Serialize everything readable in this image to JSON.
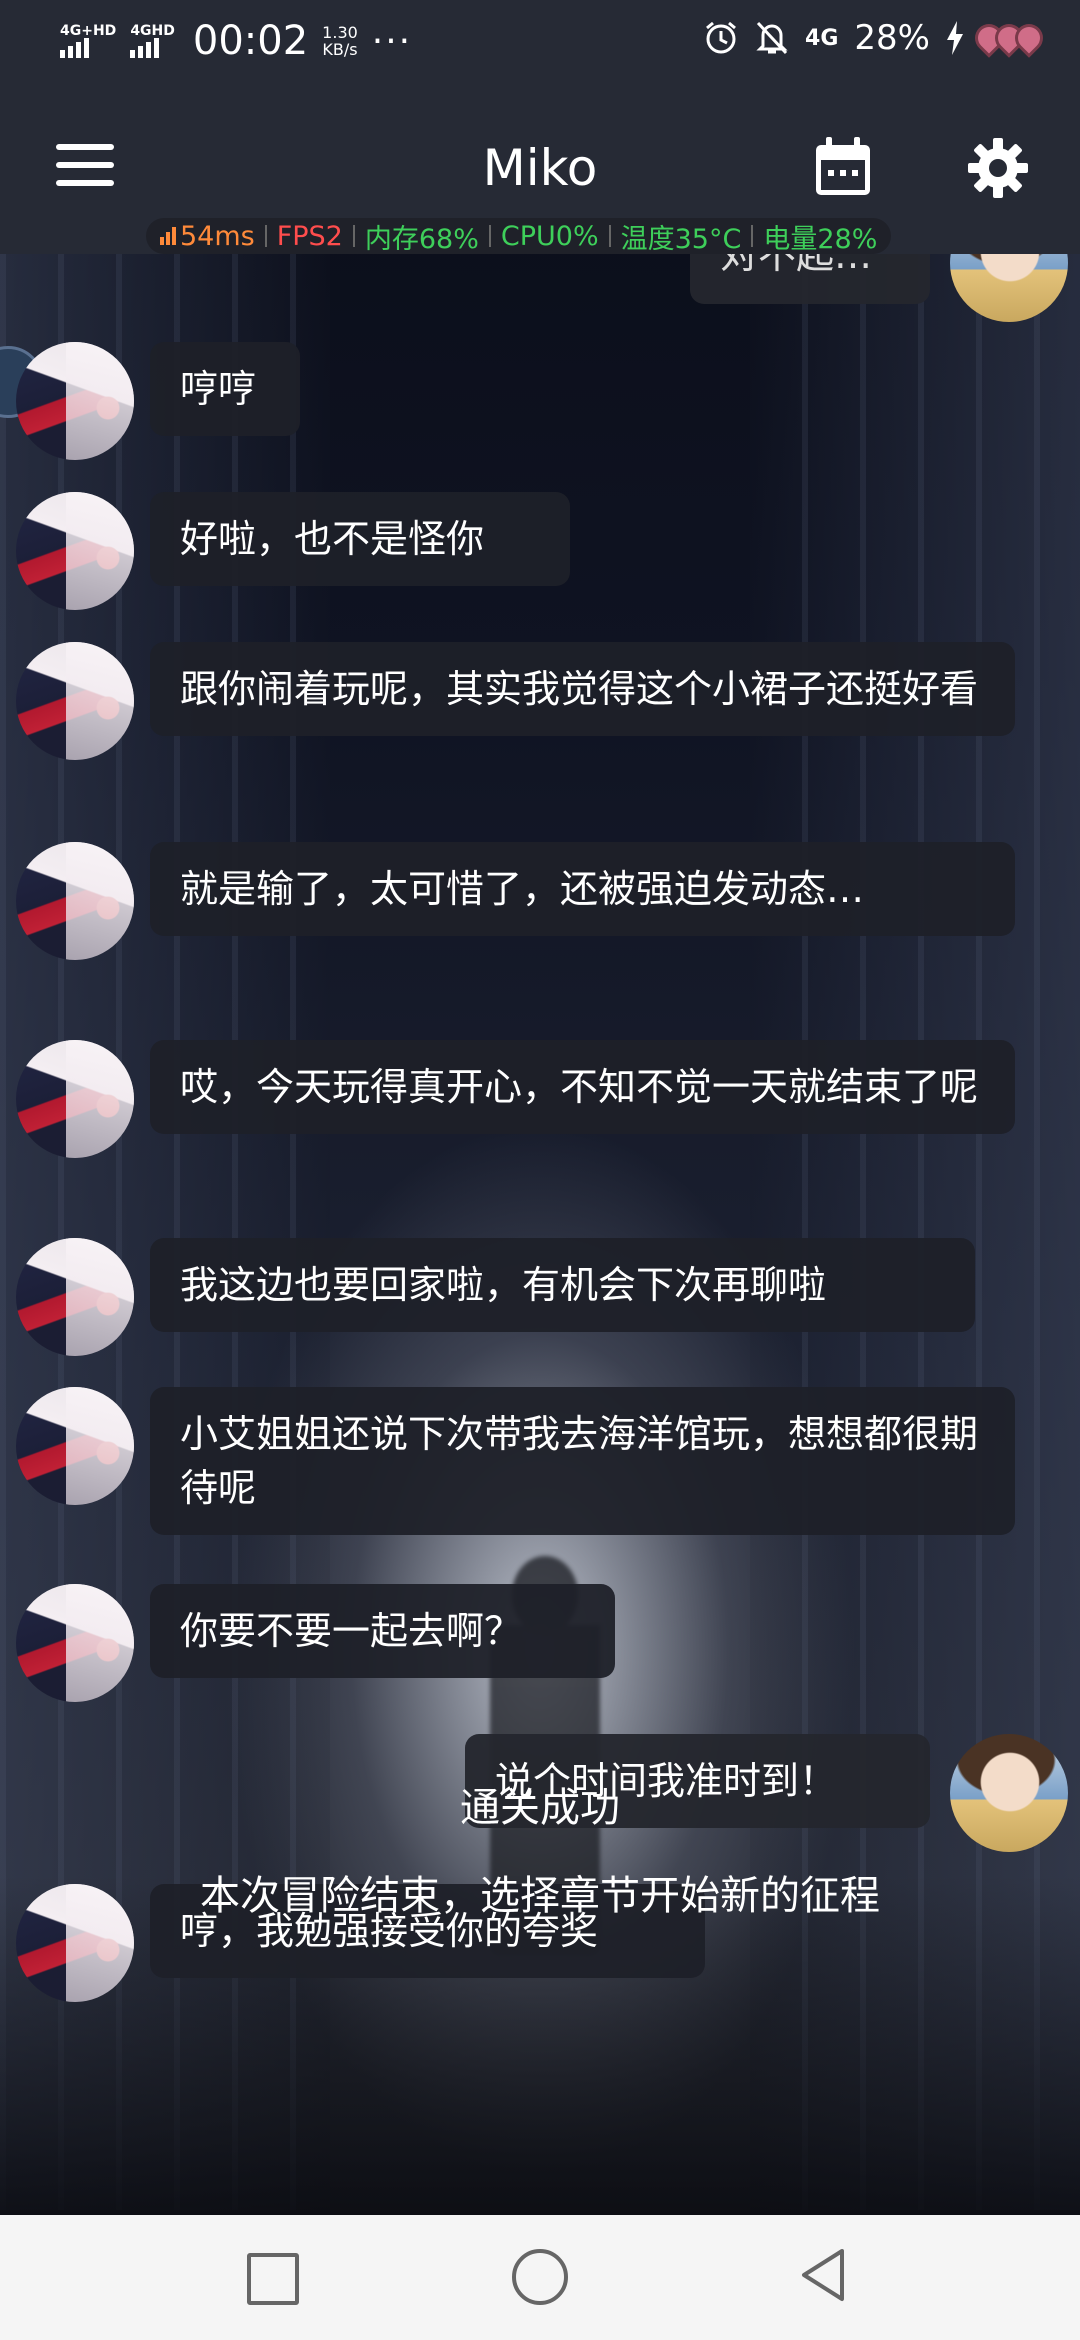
{
  "status_bar": {
    "net1": "4G+HD",
    "net2": "4GHD",
    "time": "00:02",
    "speed_value": "1.30",
    "speed_unit": "KB/s",
    "more": "···",
    "net3": "4G",
    "battery": "28%"
  },
  "app_bar": {
    "title": "Miko",
    "menu_icon": "hamburger-menu-icon",
    "calendar_icon": "calendar-icon",
    "settings_icon": "gear-icon"
  },
  "perf_overlay": {
    "ping": "54ms",
    "fps": "FPS2",
    "memory": "内存68%",
    "cpu": "CPU0%",
    "temperature": "温度35°C",
    "battery": "电量28%",
    "colors": {
      "ping": "#ff8a3a",
      "fps": "#ff4d4d",
      "ok": "#3ecf5a"
    }
  },
  "chat": {
    "partial_top": "对不起…",
    "messages": [
      {
        "sender": "Miko",
        "text": "哼哼"
      },
      {
        "sender": "Miko",
        "text": "好啦，也不是怪你"
      },
      {
        "sender": "Miko",
        "text": "跟你闹着玩呢，其实我觉得这个小裙子还挺好看"
      },
      {
        "sender": "Miko",
        "text": "就是输了，太可惜了，还被强迫发动态…"
      },
      {
        "sender": "Miko",
        "text": "哎，今天玩得真开心，不知不觉一天就结束了呢"
      },
      {
        "sender": "Miko",
        "text": "我这边也要回家啦，有机会下次再聊啦"
      },
      {
        "sender": "Miko",
        "text": "小艾姐姐还说下次带我去海洋馆玩，想想都很期待呢"
      },
      {
        "sender": "Miko",
        "text": "你要不要一起去啊？"
      },
      {
        "sender": "me",
        "text": "说个时间我准时到！"
      },
      {
        "sender": "Miko",
        "text": "哼，我勉强接受你的夸奖"
      }
    ]
  },
  "footer": {
    "title": "通关成功",
    "subtitle": "本次冒险结束，选择章节开始新的征程"
  },
  "nav_bar": {
    "recents_icon": "square-recents-icon",
    "home_icon": "circle-home-icon",
    "back_icon": "triangle-back-icon"
  }
}
